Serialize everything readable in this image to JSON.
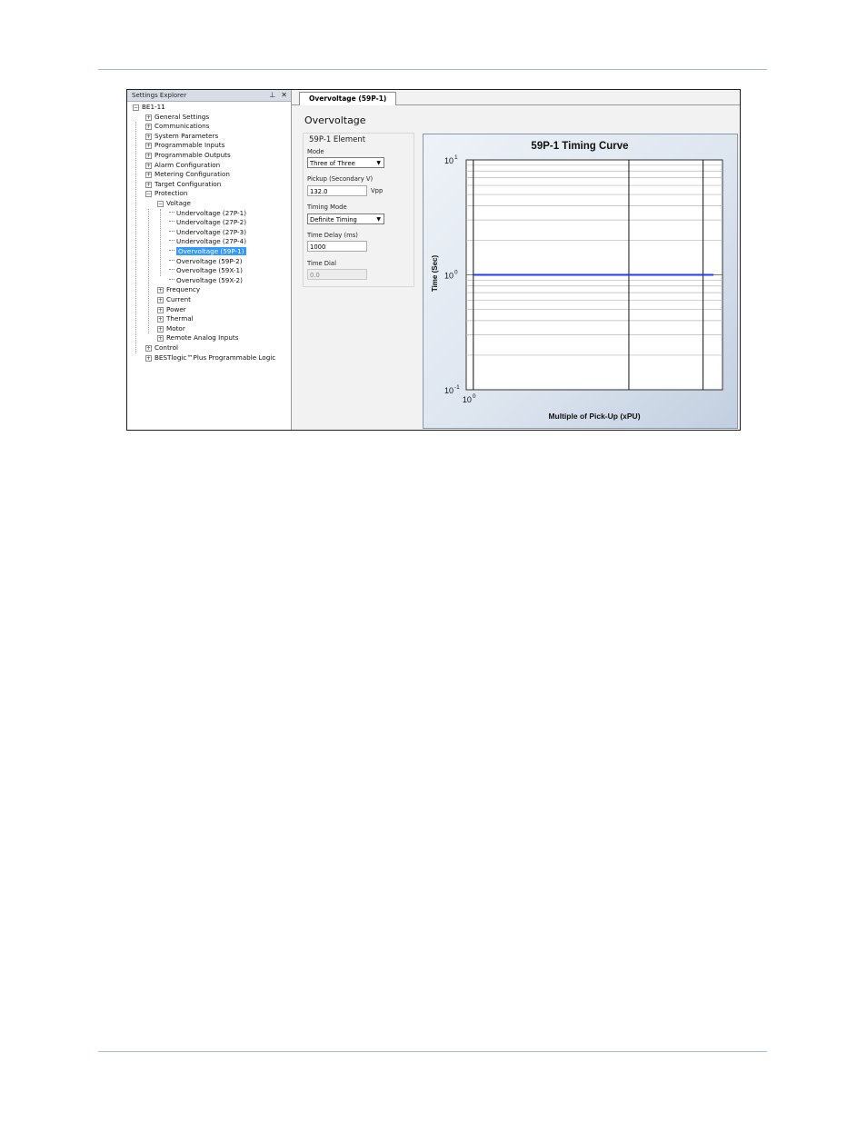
{
  "explorer": {
    "title": "Settings Explorer",
    "pin_icon": "pin-icon",
    "close_icon": "close-icon",
    "root": "BE1-11",
    "nodes": [
      {
        "label": "General Settings",
        "level": 1,
        "expander": "+"
      },
      {
        "label": "Communications",
        "level": 1,
        "expander": "+"
      },
      {
        "label": "System Parameters",
        "level": 1,
        "expander": "+"
      },
      {
        "label": "Programmable Inputs",
        "level": 1,
        "expander": "+"
      },
      {
        "label": "Programmable Outputs",
        "level": 1,
        "expander": "+"
      },
      {
        "label": "Alarm Configuration",
        "level": 1,
        "expander": "+"
      },
      {
        "label": "Metering Configuration",
        "level": 1,
        "expander": "+"
      },
      {
        "label": "Target Configuration",
        "level": 1,
        "expander": "+"
      },
      {
        "label": "Protection",
        "level": 1,
        "expander": "−"
      },
      {
        "label": "Voltage",
        "level": 2,
        "expander": "−"
      },
      {
        "label": "Undervoltage (27P-1)",
        "level": 3,
        "expander": ""
      },
      {
        "label": "Undervoltage (27P-2)",
        "level": 3,
        "expander": ""
      },
      {
        "label": "Undervoltage (27P-3)",
        "level": 3,
        "expander": ""
      },
      {
        "label": "Undervoltage (27P-4)",
        "level": 3,
        "expander": ""
      },
      {
        "label": "Overvoltage (59P-1)",
        "level": 3,
        "expander": "",
        "selected": true
      },
      {
        "label": "Overvoltage (59P-2)",
        "level": 3,
        "expander": ""
      },
      {
        "label": "Overvoltage (59X-1)",
        "level": 3,
        "expander": ""
      },
      {
        "label": "Overvoltage (59X-2)",
        "level": 3,
        "expander": ""
      },
      {
        "label": "Frequency",
        "level": 2,
        "expander": "+"
      },
      {
        "label": "Current",
        "level": 2,
        "expander": "+"
      },
      {
        "label": "Power",
        "level": 2,
        "expander": "+"
      },
      {
        "label": "Thermal",
        "level": 2,
        "expander": "+"
      },
      {
        "label": "Motor",
        "level": 2,
        "expander": "+"
      },
      {
        "label": "Remote Analog Inputs",
        "level": 2,
        "expander": "+"
      },
      {
        "label": "Control",
        "level": 1,
        "expander": "+"
      },
      {
        "label": "BESTlogic™Plus Programmable Logic",
        "level": 1,
        "expander": "+"
      }
    ]
  },
  "tab": {
    "label": "Overvoltage (59P-1)"
  },
  "section_title": "Overvoltage",
  "form": {
    "group_title": "59P-1 Element",
    "mode_label": "Mode",
    "mode_value": "Three of Three",
    "pickup_label": "Pickup (Secondary V)",
    "pickup_value": "132.0",
    "pickup_unit": "Vpp",
    "timing_mode_label": "Timing Mode",
    "timing_mode_value": "Definite Timing",
    "time_delay_label": "Time Delay (ms)",
    "time_delay_value": "1000",
    "time_dial_label": "Time Dial",
    "time_dial_value": "0.0"
  },
  "chart_data": {
    "type": "line",
    "title": "59P-1 Timing Curve",
    "xlabel": "Multiple of Pick-Up (xPU)",
    "ylabel": "Time (Sec)",
    "x_scale": "log",
    "y_scale": "log",
    "x_tick_labels": [
      "10^0"
    ],
    "y_tick_labels": [
      "10^1",
      "10^0",
      "10^-1"
    ],
    "xlim": [
      0.9,
      40
    ],
    "ylim": [
      0.1,
      10
    ],
    "grid": true,
    "series": [
      {
        "color": "#1e3cff",
        "x": [
          1,
          35
        ],
        "y": [
          1.0,
          1.0
        ]
      }
    ]
  }
}
